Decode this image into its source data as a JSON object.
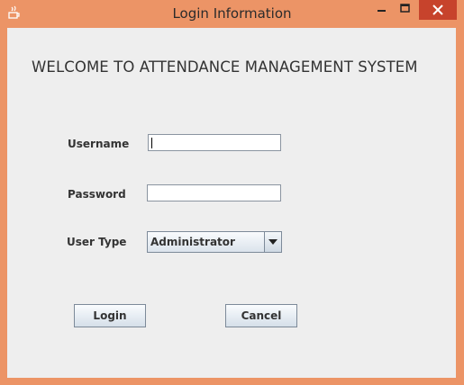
{
  "window": {
    "title": "Login Information",
    "app_icon": "java-icon",
    "colors": {
      "frame": "#ec9466",
      "close": "#c7432c",
      "content": "#eeeeee"
    }
  },
  "heading": "WELCOME TO ATTENDANCE MANAGEMENT SYSTEM",
  "form": {
    "username_label": "Username",
    "username_value": "",
    "password_label": "Password",
    "password_value": "",
    "usertype_label": "User Type",
    "usertype_value": "Administrator"
  },
  "buttons": {
    "login": "Login",
    "cancel": "Cancel"
  }
}
